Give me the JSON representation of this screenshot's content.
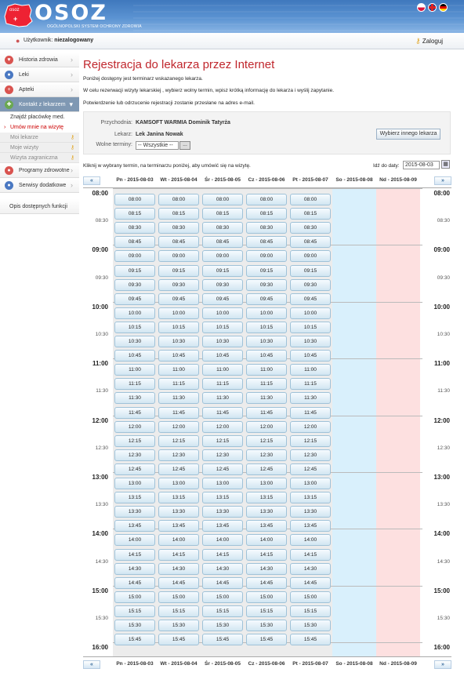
{
  "header": {
    "logo_text": "OSOZ",
    "logo_sub": "OGÓLNOPOLSKI SYSTEM OCHRONY ZDROWIA",
    "logo_mark": "osoz"
  },
  "userbar": {
    "user_label": "Użytkownik:",
    "user_value": "niezalogowany",
    "login_label": "Zaloguj"
  },
  "sidebar": {
    "items": [
      {
        "label": "Historia zdrowia",
        "icon": "heart-icon",
        "color": "#d9534f"
      },
      {
        "label": "Leki",
        "icon": "pill-icon",
        "color": "#4a78c2"
      },
      {
        "label": "Apteki",
        "icon": "cross-icon",
        "color": "#d9534f"
      },
      {
        "label": "Kontakt z lekarzem",
        "icon": "stethoscope-icon",
        "color": "#6aa84f"
      }
    ],
    "subitems": [
      {
        "label": "Znajdź placówkę med.",
        "state": "normal"
      },
      {
        "label": "Umów mnie na wizytę",
        "state": "selected"
      },
      {
        "label": "Moi lekarze",
        "state": "disabled"
      },
      {
        "label": "Moje wizyty",
        "state": "disabled"
      },
      {
        "label": "Wizyta zagraniczna",
        "state": "disabled"
      }
    ],
    "bottom_items": [
      {
        "label": "Programy zdrowotne",
        "icon": "program-icon",
        "color": "#d9534f"
      },
      {
        "label": "Serwisy dodatkowe",
        "icon": "service-icon",
        "color": "#4a78c2"
      }
    ],
    "functions_link": "Opis dostępnych funkcji"
  },
  "main": {
    "title": "Rejestracja do lekarza przez Internet",
    "p1": "Poniżej dostępny jest terminarz wskazanego lekarza.",
    "p2": "W celu rezerwacji wizyty lekarskiej , wybierz wolny termin, wpisz krótką informację do lekarza i wyślij zapytanie.",
    "p3": "Potwierdzenie lub odrzucenie rejestracji zostanie przesłane na adres e-mail.",
    "filter": {
      "clinic_label": "Przychodnia:",
      "clinic_value": "KAMSOFT WARMIA Dominik Tatyrża",
      "doctor_label": "Lekarz:",
      "doctor_value": "Lek Janina Nowak",
      "slots_label": "Wolne terminy:",
      "slots_value": "-- Wszystkie --",
      "slots_btn": "...",
      "other_doctor_btn": "Wybierz innego lekarza"
    },
    "instruction": "Kliknij w wybrany termin, na terminarzu poniżej, aby umówić się na wizytę.",
    "date_label": "Idź do daty:",
    "date_value": "2015-08-03"
  },
  "calendar": {
    "prev_label": "«",
    "next_label": "»",
    "days": [
      {
        "label": "Pn - 2015-08-03",
        "kind": "weekday"
      },
      {
        "label": "Wt - 2015-08-04",
        "kind": "weekday"
      },
      {
        "label": "Śr - 2015-08-05",
        "kind": "weekday"
      },
      {
        "label": "Cz - 2015-08-06",
        "kind": "weekday"
      },
      {
        "label": "Pt - 2015-08-07",
        "kind": "weekday"
      },
      {
        "label": "So - 2015-08-08",
        "kind": "saturday"
      },
      {
        "label": "Nd - 2015-08-09",
        "kind": "sunday"
      }
    ],
    "hours": [
      "08:00",
      "08:30",
      "09:00",
      "09:30",
      "10:00",
      "10:30",
      "11:00",
      "11:30",
      "12:00",
      "12:30",
      "13:00",
      "13:30",
      "14:00",
      "14:30",
      "15:00",
      "15:30",
      "16:00"
    ],
    "slots": [
      "08:00",
      "08:15",
      "08:30",
      "08:45",
      "09:00",
      "09:15",
      "09:30",
      "09:45",
      "10:00",
      "10:15",
      "10:30",
      "10:45",
      "11:00",
      "11:15",
      "11:30",
      "11:45",
      "12:00",
      "12:15",
      "12:30",
      "12:45",
      "13:00",
      "13:15",
      "13:30",
      "13:45",
      "14:00",
      "14:15",
      "14:30",
      "14:45",
      "15:00",
      "15:15",
      "15:30",
      "15:45"
    ]
  }
}
